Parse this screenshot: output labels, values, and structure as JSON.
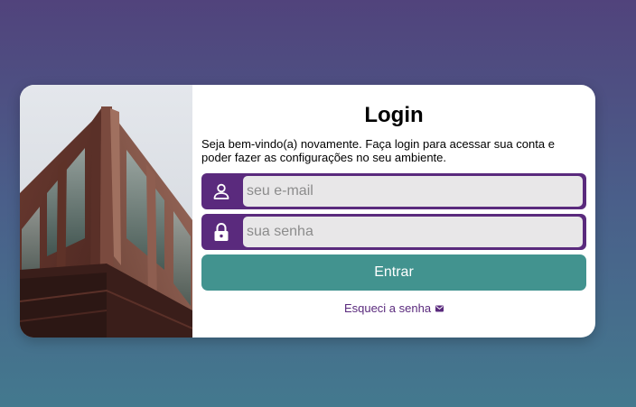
{
  "login": {
    "title": "Login",
    "subtitle": "Seja bem-vindo(a) novamente. Faça login para acessar sua conta e poder fazer as configurações no seu ambiente.",
    "email": {
      "placeholder": "seu e-mail",
      "value": "",
      "icon": "user-icon"
    },
    "password": {
      "placeholder": "sua senha",
      "value": "",
      "icon": "lock-icon"
    },
    "submit_label": "Entrar",
    "forgot_label": "Esqueci a senha",
    "forgot_icon": "envelope-icon"
  },
  "colors": {
    "accent": "#5a2a7d",
    "button": "#42938f",
    "input_bg": "#e8e7e8"
  }
}
